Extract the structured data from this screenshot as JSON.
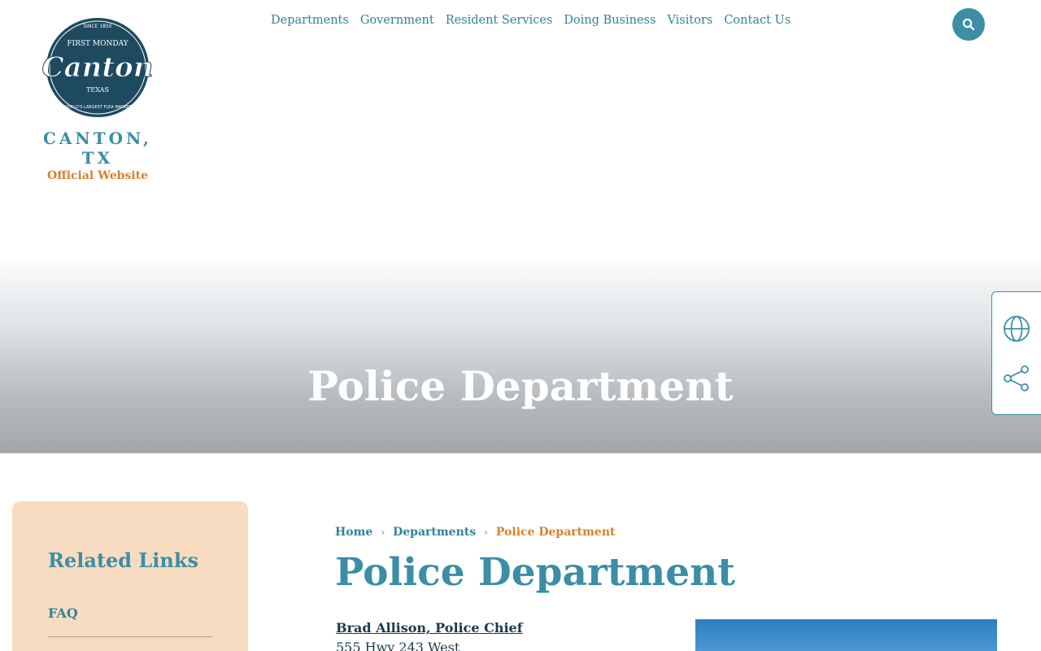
{
  "header": {
    "logo": {
      "badge_top": "SINCE 1850",
      "badge_line1": "FIRST MONDAY",
      "badge_script": "Canton",
      "badge_state": "TEXAS",
      "badge_bottom": "WORLD'S LARGEST FLEA MARKET",
      "city": "CANTON, TX",
      "subtitle": "Official Website"
    },
    "nav": [
      {
        "label": "Departments"
      },
      {
        "label": "Government"
      },
      {
        "label": "Resident Services"
      },
      {
        "label": "Doing Business"
      },
      {
        "label": "Visitors"
      },
      {
        "label": "Contact Us"
      }
    ],
    "search_icon": "search-icon"
  },
  "hero": {
    "title": "Police Department"
  },
  "side_tools": {
    "icons": [
      "globe-icon",
      "share-icon"
    ]
  },
  "sidebar": {
    "title": "Related Links",
    "links": [
      {
        "label": "FAQ"
      }
    ]
  },
  "breadcrumb": {
    "items": [
      {
        "label": "Home"
      },
      {
        "label": "Departments"
      }
    ],
    "current": "Police Department"
  },
  "main": {
    "title": "Police Department",
    "chief_link": "Brad Allison, Police Chief",
    "address_line": "555 Hwy 243 West"
  },
  "colors": {
    "primary": "#3b8ea5",
    "accent": "#d9802c",
    "sidebar_bg": "#f7dcc1",
    "text_dark": "#1b3a4b"
  }
}
